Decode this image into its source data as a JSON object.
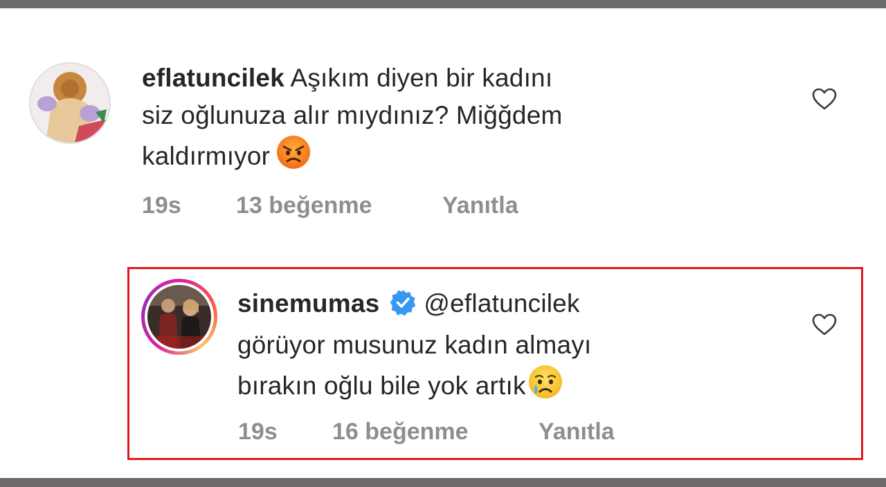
{
  "comments": [
    {
      "username": "eflatuncilek",
      "text_line1": "Aşıkım diyen bir kadını",
      "text_line2": "siz oğlunuza alır mıydınız? Miğğdem",
      "text_line3": "kaldırmıyor",
      "emoji": "angry-face",
      "time": "19s",
      "likes": "13 beğenme",
      "reply": "Yanıtla"
    },
    {
      "username": "sinemumas",
      "verified": true,
      "mention": "@eflatuncilek",
      "text_line2": "görüyor musunuz kadın almayı",
      "text_line3": "bırakın oğlu bile yok artık",
      "emoji": "crying-face",
      "time": "19s",
      "likes": "16 beğenme",
      "reply": "Yanıtla"
    }
  ],
  "colors": {
    "text": "#262626",
    "meta": "#8e8e8e",
    "verified": "#3897f0",
    "highlight": "#e0191e",
    "frame": "#6e6a69"
  }
}
